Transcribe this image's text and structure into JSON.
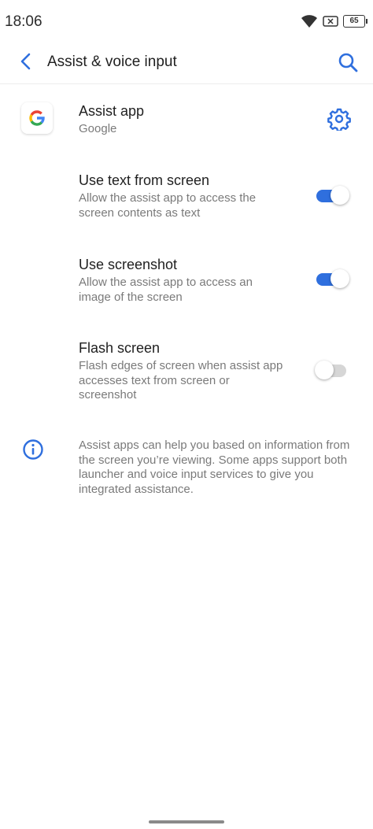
{
  "status_bar": {
    "time": "18:06",
    "battery": "65"
  },
  "app_bar": {
    "title": "Assist & voice input"
  },
  "assist_app": {
    "title": "Assist app",
    "value": "Google"
  },
  "settings": [
    {
      "title": "Use text from screen",
      "subtitle": "Allow the assist app to access the screen contents as text",
      "enabled": true
    },
    {
      "title": "Use screenshot",
      "subtitle": "Allow the assist app to access an image of the screen",
      "enabled": true
    },
    {
      "title": "Flash screen",
      "subtitle": "Flash edges of screen when assist app accesses text from screen or screenshot",
      "enabled": false
    }
  ],
  "info": {
    "text": "Assist apps can help you based on information from the screen you’re viewing. Some apps support both launcher and voice input services to give you integrated assistance."
  },
  "colors": {
    "accent": "#2f6fde",
    "track_off": "#d6d6d6"
  },
  "icons": [
    "wifi-icon",
    "sim-icon",
    "battery-icon",
    "back-arrow-icon",
    "search-icon",
    "google-icon",
    "gear-icon",
    "info-icon"
  ]
}
